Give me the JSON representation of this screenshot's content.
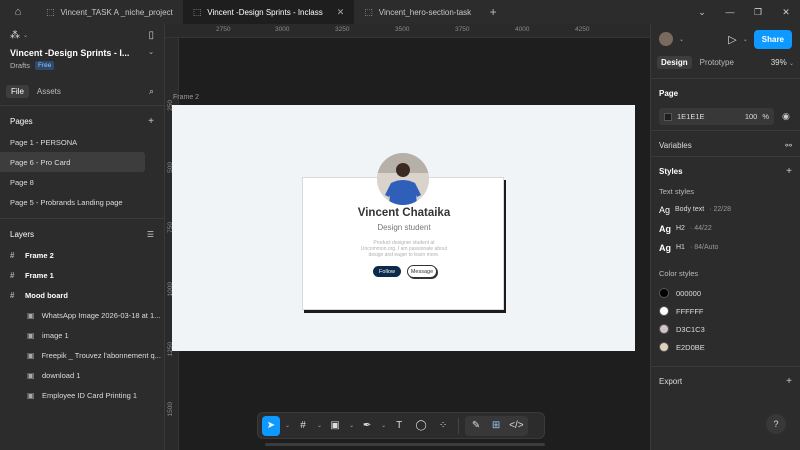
{
  "tabs": [
    {
      "label": "Vincent_TASK A _niche_project",
      "active": false
    },
    {
      "label": "Vincent -Design Sprints - Inclass",
      "active": true
    },
    {
      "label": "Vincent_hero-section-task",
      "active": false
    }
  ],
  "project": {
    "title": "Vincent -Design Sprints - I...",
    "drafts": "Drafts",
    "plan": "Free"
  },
  "left_tabs": {
    "file": "File",
    "assets": "Assets"
  },
  "pages": {
    "title": "Pages",
    "items": [
      "Page 1 - PERSONA",
      "Page 6 - Pro Card",
      "Page 8",
      "Page 5 - Probrands Landing page"
    ]
  },
  "layers": {
    "title": "Layers",
    "items": [
      {
        "label": "Frame 2",
        "level": 0
      },
      {
        "label": "Frame 1",
        "level": 0
      },
      {
        "label": "Mood board",
        "level": 0
      },
      {
        "label": "WhatsApp Image 2026-03-18 at 1...",
        "level": 1
      },
      {
        "label": "image 1",
        "level": 1
      },
      {
        "label": "Freepik _ Trouvez l'abonnement q...",
        "level": 1
      },
      {
        "label": "download 1",
        "level": 1
      },
      {
        "label": "Employee ID Card Printing 1",
        "level": 1
      }
    ]
  },
  "rulers": {
    "top": [
      "2750",
      "3000",
      "3250",
      "3500",
      "3750",
      "4000",
      "4250"
    ],
    "left": [
      "250",
      "500",
      "750",
      "1000",
      "1250",
      "1500"
    ]
  },
  "frame": {
    "label": "Frame 2"
  },
  "card": {
    "name": "Vincent Chataika",
    "role": "Design student",
    "bio": "Product designer student at Uncommon.org. I am passionate about design and eager to learn more.",
    "follow": "Follow",
    "message": "Message"
  },
  "right": {
    "share": "Share",
    "design_tab": "Design",
    "prototype_tab": "Prototype",
    "zoom": "39%",
    "page_title": "Page",
    "page_color": "1E1E1E",
    "page_opacity": "100",
    "page_pct": "%",
    "variables": "Variables",
    "styles": "Styles",
    "text_styles_title": "Text styles",
    "text_styles": [
      {
        "name": "Body text",
        "meta": "· 22/28"
      },
      {
        "name": "H2",
        "meta": "· 44/22"
      },
      {
        "name": "H1",
        "meta": "· 84/Auto"
      }
    ],
    "color_styles_title": "Color styles",
    "color_styles": [
      {
        "name": "000000",
        "color": "#000000"
      },
      {
        "name": "FFFFFF",
        "color": "#FFFFFF"
      },
      {
        "name": "D3C1C3",
        "color": "#D3C1C3"
      },
      {
        "name": "E2D0BE",
        "color": "#E2D0BE"
      }
    ],
    "export": "Export"
  },
  "colors": {
    "accent": "#0d99ff",
    "canvas": "#1e1e1e",
    "panel": "#2c2c2c",
    "follow_button": "#0c2a4a"
  }
}
